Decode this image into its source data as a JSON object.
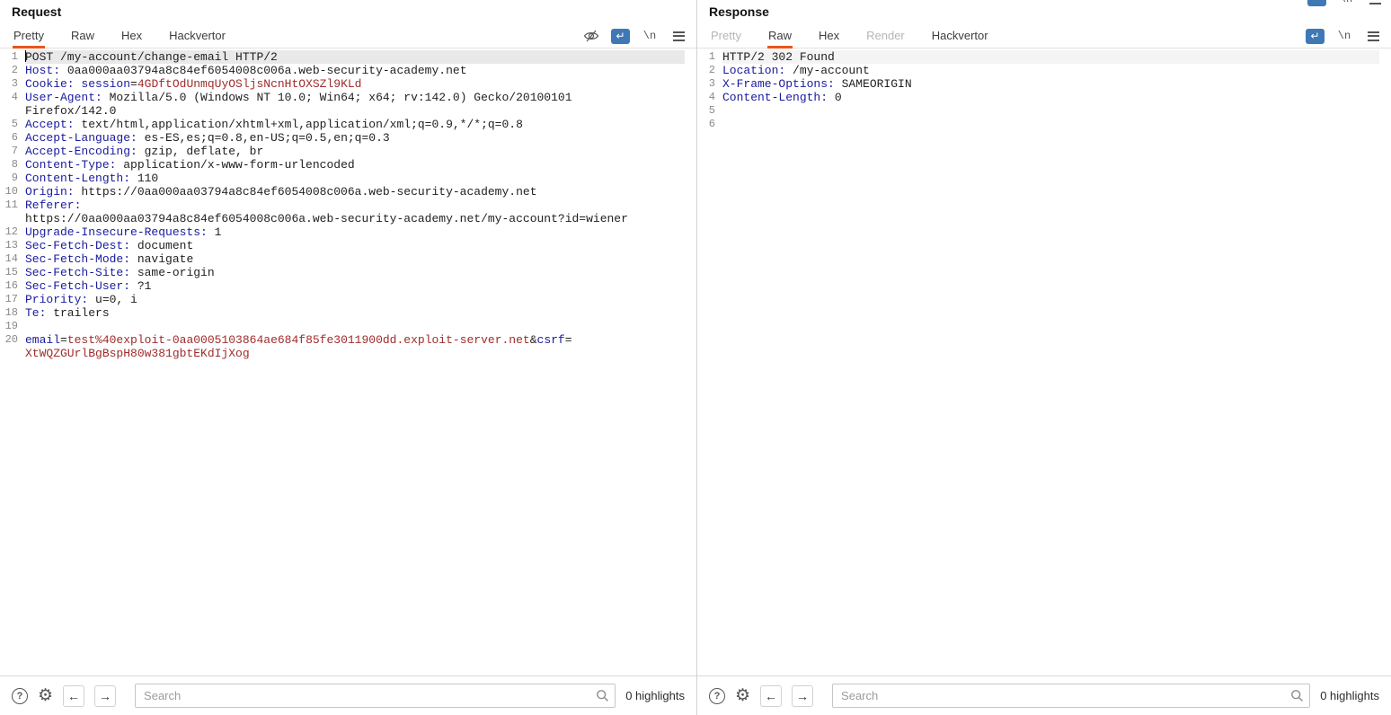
{
  "colors": {
    "accent": "#e8571d",
    "header_name": "#181a9e",
    "value": "#a02c2c",
    "text": "#1f1f1f",
    "line_number": "#8a8a8a",
    "selection": "#e9e9e9",
    "selection_light": "#f4f4f4",
    "wrap_icon_bg": "#3e79b6",
    "divider": "#d0d0d0"
  },
  "request": {
    "title": "Request",
    "tabs": [
      {
        "label": "Pretty",
        "state": "selected"
      },
      {
        "label": "Raw",
        "state": "normal"
      },
      {
        "label": "Hex",
        "state": "normal"
      },
      {
        "label": "Hackvertor",
        "state": "normal"
      }
    ],
    "toolbar": {
      "icons": [
        "visibility-off-icon",
        "word-wrap-icon",
        "newline-icon",
        "menu-icon"
      ],
      "wrap_glyph": "↵",
      "newline_label": "\\n"
    },
    "editor": {
      "lines": [
        {
          "n": 1,
          "hl": "sel",
          "caret": true,
          "segs": [
            [
              "t",
              "POST /my-account/change-email HTTP/2"
            ]
          ]
        },
        {
          "n": 2,
          "segs": [
            [
              "h",
              "Host:"
            ],
            [
              "t",
              " 0aa000aa03794a8c84ef6054008c006a.web-security-academy.net"
            ]
          ]
        },
        {
          "n": 3,
          "segs": [
            [
              "h",
              "Cookie:"
            ],
            [
              "t",
              " "
            ],
            [
              "h",
              "session"
            ],
            [
              "t",
              "="
            ],
            [
              "v",
              "4GDftOdUnmqUyOSljsNcnHtOXSZl9KLd"
            ]
          ]
        },
        {
          "n": 4,
          "segs": [
            [
              "h",
              "User-Agent:"
            ],
            [
              "t",
              " Mozilla/5.0 (Windows NT 10.0; Win64; x64; rv:142.0) Gecko/20100101"
            ],
            [
              "br"
            ],
            [
              "t",
              "Firefox/142.0"
            ]
          ]
        },
        {
          "n": 5,
          "segs": [
            [
              "h",
              "Accept:"
            ],
            [
              "t",
              " text/html,application/xhtml+xml,application/xml;q=0.9,*/*;q=0.8"
            ]
          ]
        },
        {
          "n": 6,
          "segs": [
            [
              "h",
              "Accept-Language:"
            ],
            [
              "t",
              " es-ES,es;q=0.8,en-US;q=0.5,en;q=0.3"
            ]
          ]
        },
        {
          "n": 7,
          "segs": [
            [
              "h",
              "Accept-Encoding:"
            ],
            [
              "t",
              " gzip, deflate, br"
            ]
          ]
        },
        {
          "n": 8,
          "segs": [
            [
              "h",
              "Content-Type:"
            ],
            [
              "t",
              " application/x-www-form-urlencoded"
            ]
          ]
        },
        {
          "n": 9,
          "segs": [
            [
              "h",
              "Content-Length:"
            ],
            [
              "t",
              " 110"
            ]
          ]
        },
        {
          "n": 10,
          "segs": [
            [
              "h",
              "Origin:"
            ],
            [
              "t",
              " https://0aa000aa03794a8c84ef6054008c006a.web-security-academy.net"
            ]
          ]
        },
        {
          "n": 11,
          "segs": [
            [
              "h",
              "Referer:"
            ],
            [
              "br"
            ],
            [
              "t",
              "https://0aa000aa03794a8c84ef6054008c006a.web-security-academy.net/my-account?id=wiener"
            ]
          ]
        },
        {
          "n": 12,
          "segs": [
            [
              "h",
              "Upgrade-Insecure-Requests:"
            ],
            [
              "t",
              " 1"
            ]
          ]
        },
        {
          "n": 13,
          "segs": [
            [
              "h",
              "Sec-Fetch-Dest:"
            ],
            [
              "t",
              " document"
            ]
          ]
        },
        {
          "n": 14,
          "segs": [
            [
              "h",
              "Sec-Fetch-Mode:"
            ],
            [
              "t",
              " navigate"
            ]
          ]
        },
        {
          "n": 15,
          "segs": [
            [
              "h",
              "Sec-Fetch-Site:"
            ],
            [
              "t",
              " same-origin"
            ]
          ]
        },
        {
          "n": 16,
          "segs": [
            [
              "h",
              "Sec-Fetch-User:"
            ],
            [
              "t",
              " ?1"
            ]
          ]
        },
        {
          "n": 17,
          "segs": [
            [
              "h",
              "Priority:"
            ],
            [
              "t",
              " u=0, i"
            ]
          ]
        },
        {
          "n": 18,
          "segs": [
            [
              "h",
              "Te:"
            ],
            [
              "t",
              " trailers"
            ]
          ]
        },
        {
          "n": 19,
          "segs": []
        },
        {
          "n": 20,
          "segs": [
            [
              "h",
              "email"
            ],
            [
              "t",
              "="
            ],
            [
              "v",
              "test%40exploit-0aa0005103864ae684f85fe3011900dd.exploit-server.net"
            ],
            [
              "t",
              "&"
            ],
            [
              "h",
              "csrf"
            ],
            [
              "t",
              "="
            ],
            [
              "br"
            ],
            [
              "v",
              "XtWQZGUrlBgBspH80w381gbtEKdIjXog"
            ]
          ]
        }
      ]
    },
    "footer": {
      "search_placeholder": "Search",
      "highlights_label": "0 highlights"
    }
  },
  "response": {
    "title": "Response",
    "tabs": [
      {
        "label": "Pretty",
        "state": "disabled"
      },
      {
        "label": "Raw",
        "state": "selected"
      },
      {
        "label": "Hex",
        "state": "normal"
      },
      {
        "label": "Render",
        "state": "disabled"
      },
      {
        "label": "Hackvertor",
        "state": "normal"
      }
    ],
    "toolbar": {
      "icons": [
        "word-wrap-icon",
        "newline-icon",
        "menu-icon"
      ],
      "wrap_glyph": "↵",
      "newline_label": "\\n"
    },
    "editor": {
      "lines": [
        {
          "n": 1,
          "hl": "light",
          "segs": [
            [
              "t",
              "HTTP/2 302 Found"
            ]
          ]
        },
        {
          "n": 2,
          "segs": [
            [
              "h",
              "Location:"
            ],
            [
              "t",
              " /my-account"
            ]
          ]
        },
        {
          "n": 3,
          "segs": [
            [
              "h",
              "X-Frame-Options:"
            ],
            [
              "t",
              " SAMEORIGIN"
            ]
          ]
        },
        {
          "n": 4,
          "segs": [
            [
              "h",
              "Content-Length:"
            ],
            [
              "t",
              " 0"
            ]
          ]
        },
        {
          "n": 5,
          "segs": []
        },
        {
          "n": 6,
          "segs": []
        }
      ]
    },
    "footer": {
      "search_placeholder": "Search",
      "highlights_label": "0 highlights"
    }
  }
}
